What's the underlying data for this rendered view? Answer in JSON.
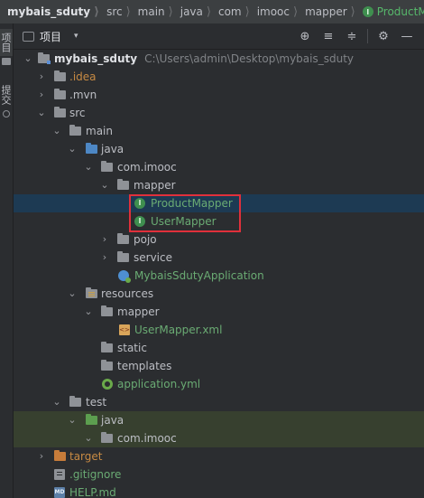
{
  "breadcrumbs": [
    {
      "label": "mybais_sduty"
    },
    {
      "label": "src"
    },
    {
      "label": "main"
    },
    {
      "label": "java"
    },
    {
      "label": "com"
    },
    {
      "label": "imooc"
    },
    {
      "label": "mapper"
    },
    {
      "label": "ProductMapper",
      "icon": "interface-icon",
      "badge": "I"
    }
  ],
  "left_strip": {
    "tabs": [
      {
        "label": "项目",
        "active": true
      },
      {
        "label": "提交",
        "active": false
      }
    ]
  },
  "toolbar": {
    "title": "项目",
    "dropdown_glyph": "▾",
    "tools": [
      {
        "icon": "locate-icon",
        "glyph": "⊕"
      },
      {
        "icon": "expand-all-icon",
        "glyph": "≡"
      },
      {
        "icon": "collapse-all-icon",
        "glyph": "≑"
      },
      {
        "icon": "settings-icon",
        "glyph": "⚙"
      },
      {
        "icon": "hide-icon",
        "glyph": "—"
      }
    ]
  },
  "tree": {
    "root_label": "mybais_sduty",
    "root_path": "C:\\Users\\admin\\Desktop\\mybais_sduty",
    "items": {
      "idea": ".idea",
      "mvn": ".mvn",
      "src": "src",
      "main": "main",
      "java": "java",
      "com_imooc": "com.imooc",
      "mapper": "mapper",
      "product_mapper": "ProductMapper",
      "user_mapper": "UserMapper",
      "pojo": "pojo",
      "service": "service",
      "app": "MybaisSdutyApplication",
      "resources": "resources",
      "res_mapper": "mapper",
      "user_mapper_xml": "UserMapper.xml",
      "static": "static",
      "templates": "templates",
      "application_yml": "application.yml",
      "test": "test",
      "test_java": "java",
      "test_com_imooc": "com.imooc",
      "target": "target",
      "gitignore": ".gitignore",
      "help_md": "HELP.md"
    },
    "interface_badge": "I",
    "glyphs": {
      "expanded": "⌄",
      "collapsed": "›"
    },
    "selected": "product_mapper",
    "highlight_color": "#e0303b"
  }
}
